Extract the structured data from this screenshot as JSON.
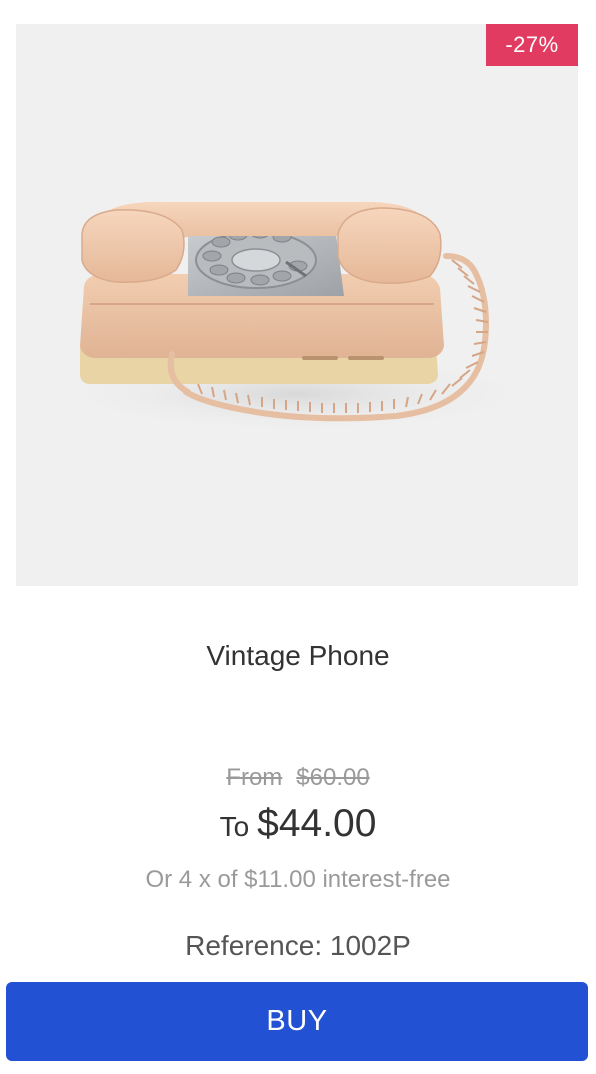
{
  "product": {
    "image_subject": "vintage-rotary-phone",
    "discount_badge": "-27%",
    "name": "Vintage Phone",
    "price_from_label": "From",
    "price_from_value": "$60.00",
    "price_to_label": "To",
    "price_to_value": "$44.00",
    "installments_text": "Or 4 x of $11.00 interest-free",
    "reference_text": "Reference: 1002P"
  },
  "actions": {
    "buy_label": "BUY"
  },
  "colors": {
    "badge": "#e23b62",
    "buy_button": "#2251d4",
    "image_background": "#f0f0f0"
  }
}
